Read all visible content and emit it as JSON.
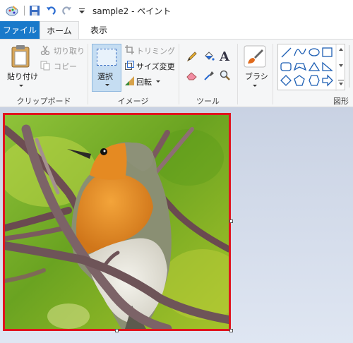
{
  "window": {
    "title": "sample2 - ペイント"
  },
  "tabs": {
    "file": "ファイル",
    "home": "ホーム",
    "view": "表示"
  },
  "clipboard": {
    "paste": "貼り付け",
    "cut": "切り取り",
    "copy": "コピー",
    "label": "クリップボード"
  },
  "image": {
    "select": "選択",
    "crop": "トリミング",
    "resize": "サイズ変更",
    "rotate": "回転",
    "label": "イメージ"
  },
  "tools": {
    "label": "ツール"
  },
  "brushes": {
    "label": "ブラシ"
  },
  "shapes": {
    "label": "図形"
  },
  "colors": {
    "accent": "#1979ca",
    "selection": "#e0141e"
  }
}
